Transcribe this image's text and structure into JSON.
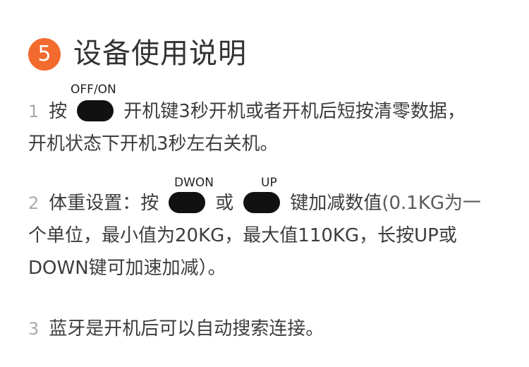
{
  "header": {
    "step_number": "5",
    "title": "设备使用说明"
  },
  "section1": {
    "number": "1",
    "press": "按",
    "key_label": "OFF/ON",
    "text_after_key": "开机键3秒开机或者开机后短按清零数据，",
    "line2": "开机状态下开机3秒左右关机。"
  },
  "section2": {
    "number": "2",
    "text_before": "体重设置：按",
    "key1_label": "DWON",
    "or_text": "或",
    "key2_label": "UP",
    "text_after": "键加减数值",
    "text_after_light": "(0.1KG为一",
    "line2": "个单位，最小值为20KG，最大值110KG，长按UP或",
    "line3": "DOWN键可加速加减）。"
  },
  "section3": {
    "number": "3",
    "text": "蓝牙是开机后可以自动搜索连接。"
  }
}
